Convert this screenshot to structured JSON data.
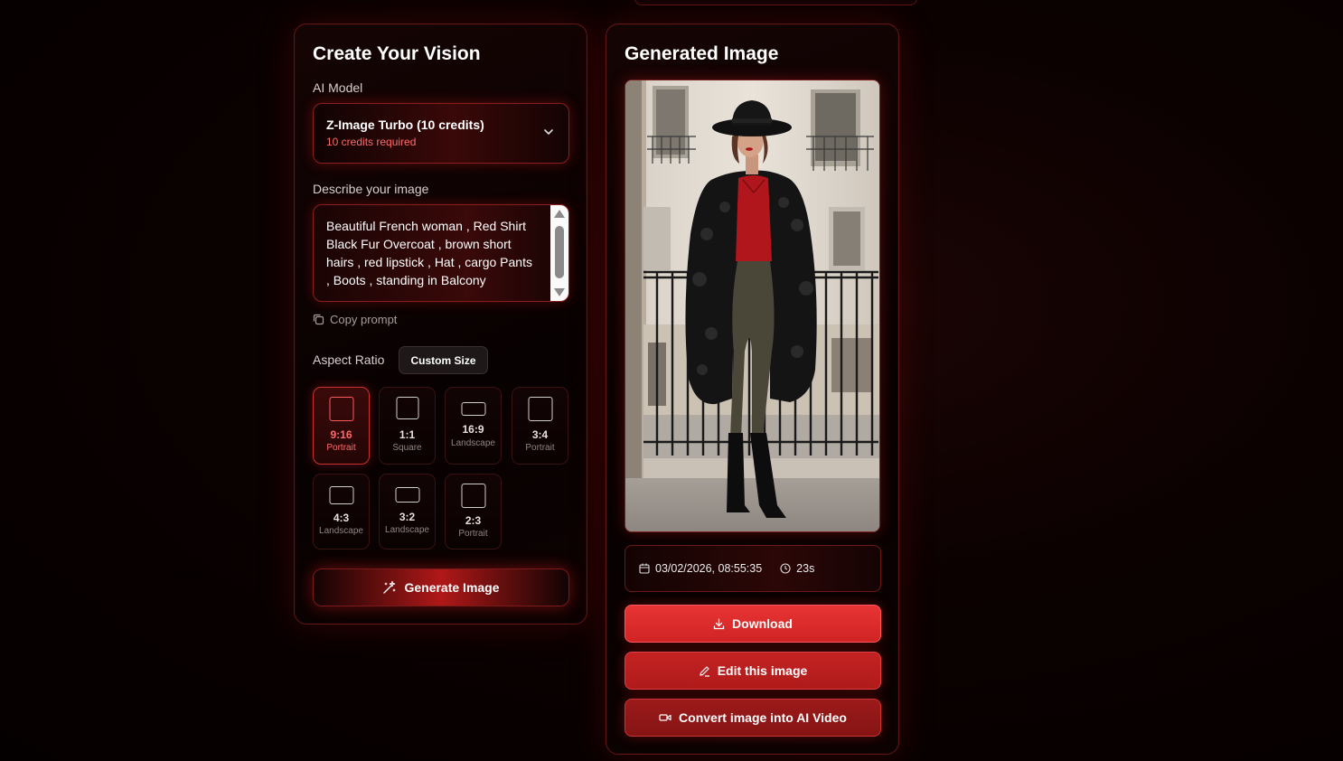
{
  "colors": {
    "accent": "#e83434",
    "accent_dark": "#861414",
    "highlight_text": "#ff6b6b",
    "background": "#050000"
  },
  "create_panel": {
    "title": "Create Your Vision",
    "model_label": "AI Model",
    "model_selected": "Z-Image Turbo (10 credits)",
    "model_credits": "10 credits required",
    "prompt_label": "Describe your image",
    "prompt_value": "Beautiful French woman , Red Shirt\nBlack Fur Overcoat , brown short\nhairs , red lipstick , Hat ,  cargo Pants\n, Boots , standing in Balcony",
    "copy_prompt": "Copy prompt",
    "aspect_label": "Aspect Ratio",
    "custom_size": "Custom Size",
    "ratios": [
      {
        "value": "9:16",
        "name": "Portrait",
        "selected": true
      },
      {
        "value": "1:1",
        "name": "Square",
        "selected": false
      },
      {
        "value": "16:9",
        "name": "Landscape",
        "selected": false
      },
      {
        "value": "3:4",
        "name": "Portrait",
        "selected": false
      },
      {
        "value": "4:3",
        "name": "Landscape",
        "selected": false
      },
      {
        "value": "3:2",
        "name": "Landscape",
        "selected": false
      },
      {
        "value": "2:3",
        "name": "Portrait",
        "selected": false
      }
    ],
    "generate_label": "Generate Image"
  },
  "result_panel": {
    "title": "Generated Image",
    "image_alt": "woman in black hat, red shirt and black fur coat standing on balcony",
    "date": "03/02/2026, 08:55:35",
    "duration": "23s",
    "download_label": "Download",
    "edit_label": "Edit this image",
    "convert_label": "Convert image into AI Video"
  }
}
